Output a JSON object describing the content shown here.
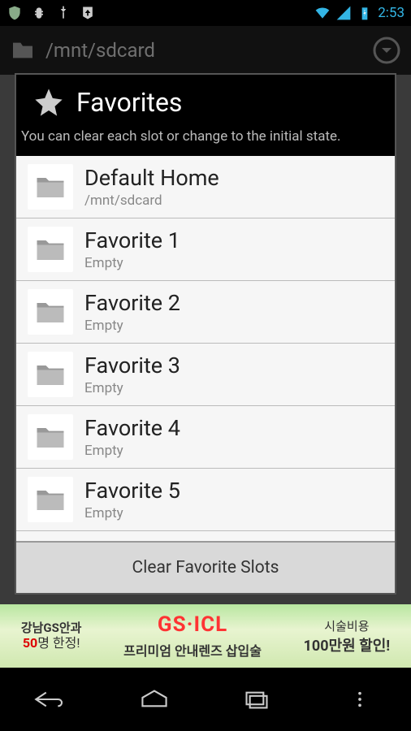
{
  "statusbar": {
    "clock": "2:53"
  },
  "toolbar": {
    "path": "/mnt/sdcard"
  },
  "dialog": {
    "title": "Favorites",
    "subtitle": "You can clear each slot or change to the initial state.",
    "items": [
      {
        "label": "Default Home",
        "sub": "/mnt/sdcard"
      },
      {
        "label": "Favorite 1",
        "sub": "Empty"
      },
      {
        "label": "Favorite 2",
        "sub": "Empty"
      },
      {
        "label": "Favorite 3",
        "sub": "Empty"
      },
      {
        "label": "Favorite 4",
        "sub": "Empty"
      },
      {
        "label": "Favorite 5",
        "sub": "Empty"
      }
    ],
    "clear_button": "Clear Favorite Slots"
  },
  "ad": {
    "left_line1": "강남GS안과",
    "left_line2_pre": "50",
    "left_line2_post": "명 한정!",
    "brand": "GS·ICL",
    "brand_sub": "프리미엄 안내렌즈 삽입술",
    "right_line1": "시술비용",
    "right_line2": "100만원 할인!"
  }
}
